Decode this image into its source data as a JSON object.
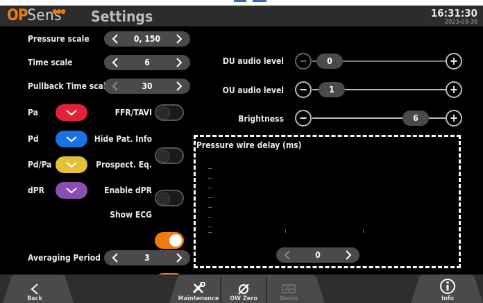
{
  "header": {
    "logo_op": "OP",
    "logo_sens": "Sens",
    "title": "Settings",
    "time": "16:31:30",
    "date": "2023-03-30"
  },
  "left": {
    "pressure_scale": {
      "label": "Pressure scale",
      "value": "0, 150"
    },
    "time_scale": {
      "label": "Time scale",
      "value": "6"
    },
    "pullback_time_scale": {
      "label": "Pullback Time scale",
      "value": "30"
    },
    "averaging_period": {
      "label": "Averaging Period",
      "value": "3"
    }
  },
  "colors": [
    {
      "label": "Pa",
      "color": "#e02335"
    },
    {
      "label": "Pd",
      "color": "#1b72e8"
    },
    {
      "label": "Pd/Pa",
      "color": "#e3c136"
    },
    {
      "label": "dPR",
      "color": "#8a4fb0"
    }
  ],
  "toggles": [
    {
      "label": "FFR/TAVI",
      "on": false
    },
    {
      "label": "Hide Pat. Info",
      "on": false
    },
    {
      "label": "Prospect. Eq.",
      "on": false
    },
    {
      "label": "Enable dPR",
      "on": true
    },
    {
      "label": "Show ECG",
      "on": true
    }
  ],
  "sliders": [
    {
      "label": "DU audio level",
      "value": "0",
      "fraction": 0.0
    },
    {
      "label": "OU audio level",
      "value": "1",
      "fraction": 0.02
    },
    {
      "label": "Brightness",
      "value": "6",
      "fraction": 1.0
    }
  ],
  "panel": {
    "title": "Pressure wire delay (ms)",
    "value": "0"
  },
  "toolbar": {
    "back": "Back",
    "maintenance": "Maintenance",
    "ow_zero": "OW Zero",
    "demo": "Demo",
    "info": "Info"
  },
  "accent": "#f07a10"
}
